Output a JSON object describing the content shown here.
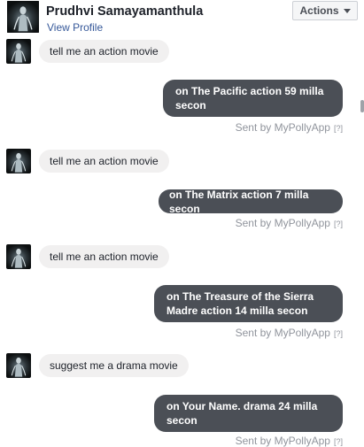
{
  "header": {
    "name": "Prudhvi Samayamanthula",
    "profile_link": "View Profile",
    "actions_label": "Actions"
  },
  "messages": [
    {
      "sender": "user",
      "text": "tell me an action movie"
    },
    {
      "sender": "bot",
      "text": "on The Pacific action 59 milla secon",
      "status": "Sent by MyPollyApp",
      "help": "[?]"
    },
    {
      "sender": "user",
      "text": "tell me an action movie"
    },
    {
      "sender": "bot",
      "text": "on The Matrix action 7 milla secon",
      "status": "Sent by MyPollyApp",
      "help": "[?]"
    },
    {
      "sender": "user",
      "text": "tell me an action movie"
    },
    {
      "sender": "bot",
      "text": "on The Treasure of the Sierra Madre action 14 milla secon",
      "status": "Sent by MyPollyApp",
      "help": "[?]"
    },
    {
      "sender": "user",
      "text": "suggest me a drama movie"
    },
    {
      "sender": "bot",
      "text": "on Your Name. drama 24 milla secon",
      "status": "Sent by MyPollyApp",
      "help": "[?]"
    }
  ],
  "colors": {
    "outgoing_bubble": "#4b4f56",
    "incoming_bubble": "#f1f0f0",
    "link": "#365899",
    "meta_text": "#90949c"
  }
}
